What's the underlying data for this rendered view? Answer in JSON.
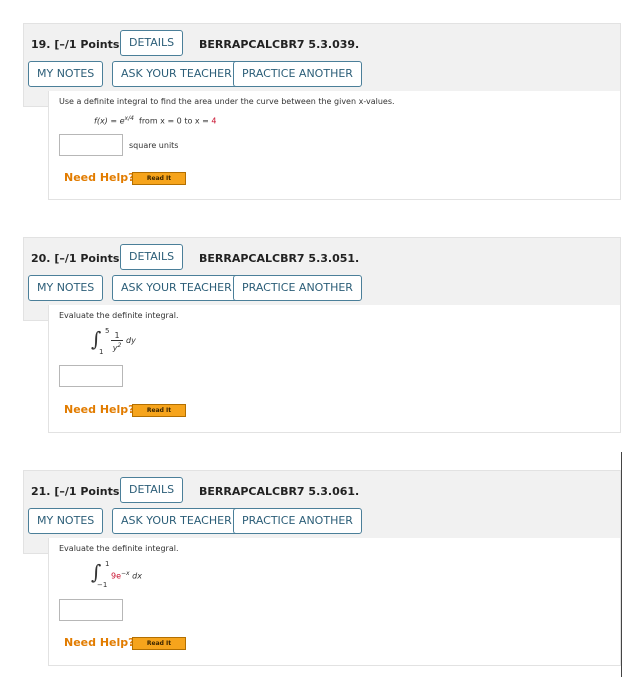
{
  "buttons": {
    "details": "DETAILS",
    "my_notes": "MY NOTES",
    "ask_teacher": "ASK YOUR TEACHER",
    "practice": "PRACTICE ANOTHER",
    "need_help": "Need Help?",
    "read_it": "Read It"
  },
  "questions": [
    {
      "title": "19. [–/1 Points]",
      "code": "BERRAPCALCBR7 5.3.039.",
      "prompt": "Use a definite integral to find the area under the curve between the given x-values.",
      "fx": "f(x) = e",
      "exponent": "x/4",
      "from": "from  x = 0   to  x =",
      "to_value": "4",
      "units": "square units"
    },
    {
      "title": "20. [–/1 Points]",
      "code": "BERRAPCALCBR7 5.3.051.",
      "prompt": "Evaluate the definite integral.",
      "upper": "5",
      "lower": "1",
      "numerator": "1",
      "denominator": "y",
      "den_exp": "2",
      "dvar": "dy"
    },
    {
      "title": "21. [–/1 Points]",
      "code": "BERRAPCALCBR7 5.3.061.",
      "prompt": "Evaluate the definite integral.",
      "upper": "1",
      "lower": "−1",
      "coef": "9e",
      "exp": "−x",
      "dvar": "dx"
    }
  ]
}
